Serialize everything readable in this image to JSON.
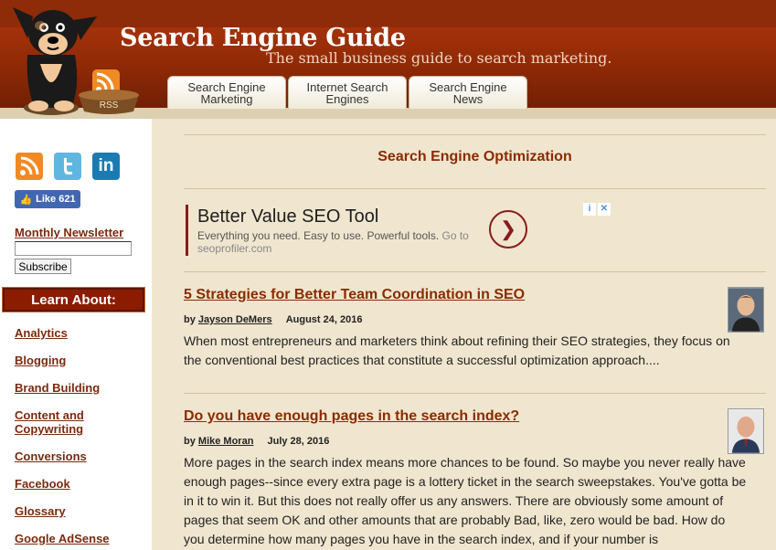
{
  "header": {
    "site_title": "Search Engine Guide",
    "tagline": "The small business guide to search marketing.",
    "rss_label": "RSS",
    "tabs": [
      {
        "label": "Search Engine Marketing"
      },
      {
        "label": "Internet Search Engines"
      },
      {
        "label": "Search Engine News"
      }
    ]
  },
  "sidebar": {
    "social": [
      {
        "icon": "rss-icon"
      },
      {
        "icon": "twitter-icon"
      },
      {
        "icon": "linkedin-icon",
        "glyph": "in"
      }
    ],
    "like_label": "Like 621",
    "newsletter_label": "Monthly Newsletter",
    "newsletter_placeholder": "",
    "subscribe_label": "Subscribe",
    "learn_about_label": "Learn About:",
    "categories": [
      {
        "label": "Analytics"
      },
      {
        "label": "Blogging"
      },
      {
        "label": "Brand Building"
      },
      {
        "label": "Content and Copywriting"
      },
      {
        "label": "Conversions"
      },
      {
        "label": "Facebook"
      },
      {
        "label": "Glossary"
      },
      {
        "label": "Google AdSense"
      }
    ]
  },
  "main": {
    "section_title": "Search Engine Optimization",
    "ad": {
      "title": "Better Value SEO Tool",
      "body": "Everything you need. Easy to use. Powerful tools.",
      "link": "Go to seoprofiler.com"
    },
    "articles": [
      {
        "title": "5 Strategies for Better Team Coordination in SEO",
        "by": "by",
        "author": "Jayson DeMers",
        "date": "August 24, 2016",
        "excerpt": "When most entrepreneurs and marketers think about refining their SEO strategies, they focus on the conventional best practices that constitute a successful optimization approach...."
      },
      {
        "title": "Do you have enough pages in the search index?",
        "by": "by",
        "author": "Mike Moran",
        "date": "July 28, 2016",
        "excerpt": "More pages in the search index means more chances to be found. So maybe you never really have enough pages--since every extra page is a lottery ticket in the search sweepstakes. You've gotta be in it to win it. But this does not really offer us any answers. There are obviously some amount of pages that seem OK and other amounts that are probably Bad, like, zero would be bad. How do you determine how many pages you have in the search index, and if your number is"
      }
    ]
  }
}
